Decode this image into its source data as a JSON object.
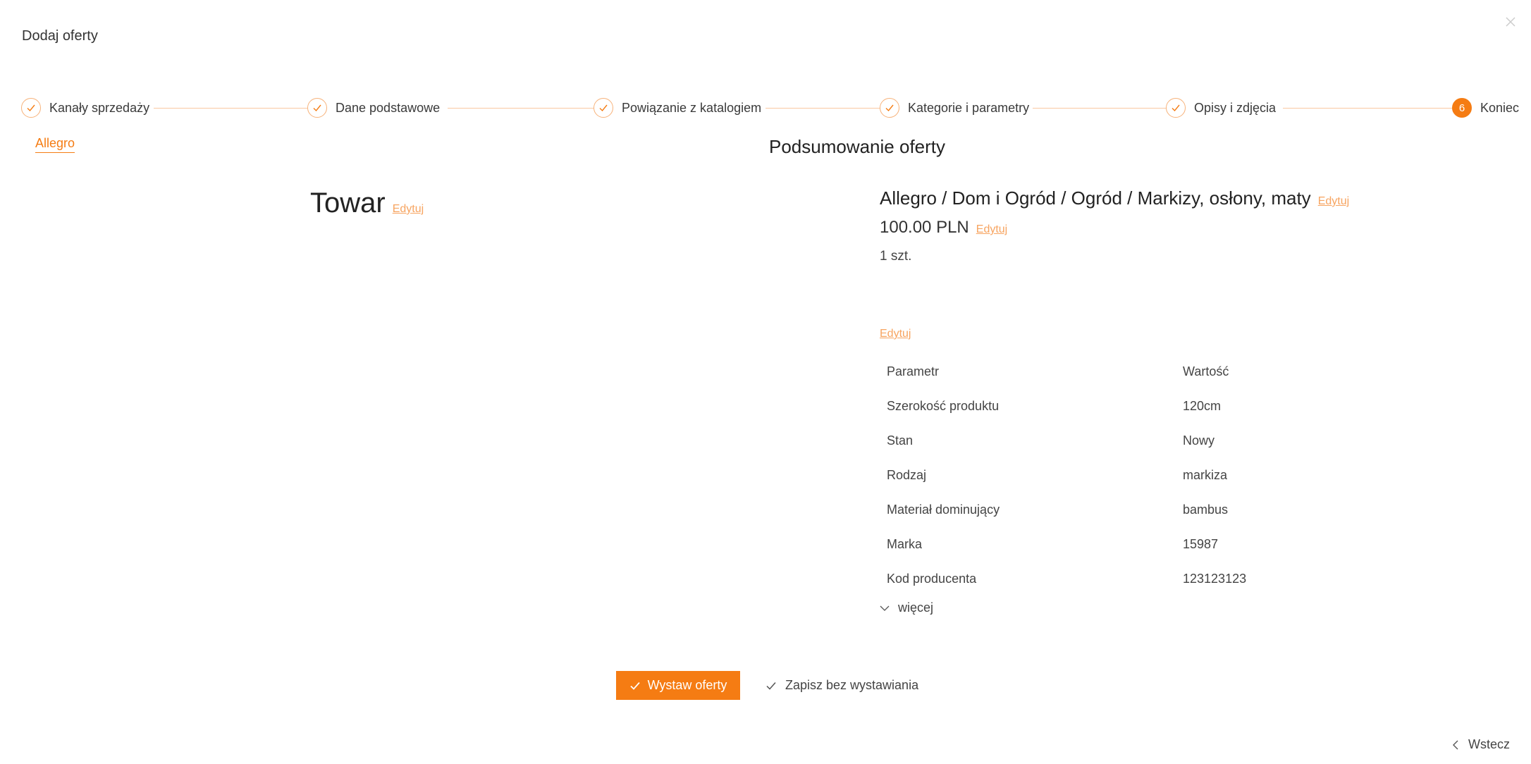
{
  "dialog": {
    "title": "Dodaj oferty"
  },
  "stepper": {
    "steps": [
      {
        "label": "Kanały sprzedaży",
        "status": "done"
      },
      {
        "label": "Dane podstawowe",
        "status": "done"
      },
      {
        "label": "Powiązanie z katalogiem",
        "status": "done"
      },
      {
        "label": "Kategorie i parametry",
        "status": "done"
      },
      {
        "label": "Opisy i zdjęcia",
        "status": "done"
      },
      {
        "label": "Koniec",
        "status": "active",
        "number": "6"
      }
    ]
  },
  "channel_tab": "Allegro",
  "summary": {
    "title": "Podsumowanie oferty",
    "product_title": "Towar",
    "edit_label": "Edytuj",
    "category": "Allegro / Dom i Ogród / Ogród / Markizy, osłony, maty",
    "price": "100.00 PLN",
    "quantity": "1 szt."
  },
  "params": {
    "header": {
      "param": "Parametr",
      "value": "Wartość"
    },
    "rows": [
      {
        "param": "Szerokość produktu",
        "value": "120cm"
      },
      {
        "param": "Stan",
        "value": "Nowy"
      },
      {
        "param": "Rodzaj",
        "value": "markiza"
      },
      {
        "param": "Materiał dominujący",
        "value": "bambus"
      },
      {
        "param": "Marka",
        "value": "15987"
      },
      {
        "param": "Kod producenta",
        "value": "123123123"
      }
    ],
    "more_label": "więcej"
  },
  "actions": {
    "publish": "Wystaw oferty",
    "save_without_publishing": "Zapisz bez wystawiania",
    "back": "Wstecz"
  },
  "colors": {
    "accent": "#f57c13",
    "accent_light": "#f9c9a2",
    "link": "#f7a460"
  }
}
